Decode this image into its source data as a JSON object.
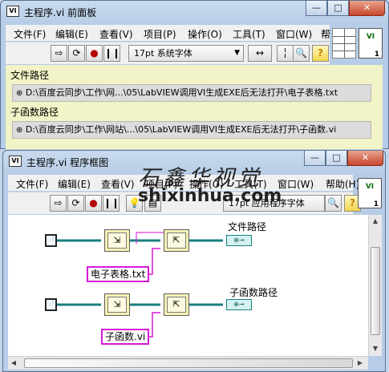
{
  "front_panel": {
    "title": "主程序.vi 前面板",
    "icon_text": "VI",
    "menu": [
      "文件(F)",
      "编辑(E)",
      "查看(V)",
      "项目(P)",
      "操作(O)",
      "工具(T)",
      "窗口(W)",
      "帮"
    ],
    "font_select": "17pt 系统字体",
    "labels": {
      "file_path": "文件路径",
      "sub_path": "子函数路径"
    },
    "values": {
      "file_path": "D:\\百度云同步\\工作\\网...\\05\\LabVIEW调用VI生成EXE后无法打开\\电子表格.txt",
      "sub_path": "D:\\百度云同步\\工作\\网站\\...\\05\\LabVIEW调用VI生成EXE后无法打开\\子函数.vi"
    },
    "vi_icon_label": "VI",
    "vi_icon_badge": "1"
  },
  "block_diagram": {
    "title": "主程序.vi 程序框图",
    "icon_text": "VI",
    "menu": [
      "文件(F)",
      "编辑(E)",
      "查看(V)",
      "项目(P)",
      "操作(O)",
      "工具(T)",
      "窗口(W)",
      "帮助(H)"
    ],
    "font_select": "17pt 应用程序字体",
    "constants": [
      "电子表格.txt",
      "子函数.vi"
    ],
    "indicator_labels": [
      "文件路径",
      "子函数路径"
    ],
    "vi_icon_label": "VI",
    "vi_icon_badge": "1"
  },
  "watermark": {
    "brand": "石鑫华视觉",
    "site": "shixinhua.com"
  },
  "icons": {
    "run": "run-arrow-icon",
    "run_continuous": "run-continuous-icon",
    "abort": "abort-icon",
    "pause": "pause-icon",
    "highlight": "highlight-execution-icon",
    "align": "align-icon",
    "distribute": "distribute-icon",
    "search": "search-icon",
    "help": "help-icon"
  },
  "colors": {
    "panel_bg": "#f2f3c6",
    "path_wire": "#1b7f7f",
    "string_wire": "#d61ad6"
  }
}
